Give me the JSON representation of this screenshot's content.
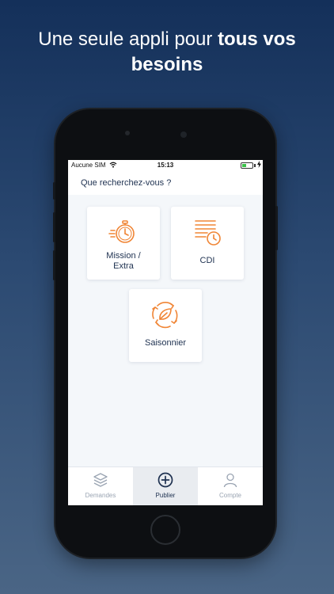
{
  "headline": {
    "line1_plain": "Une seule appli pour ",
    "line1_bold": "tous vos",
    "line2_bold": "besoins"
  },
  "statusbar": {
    "carrier": "Aucune SIM",
    "time": "15:13",
    "wifi_icon": "wifi-icon",
    "charge_icon": "charging-bolt-icon"
  },
  "header": {
    "title": "Que recherchez-vous ?"
  },
  "cards": [
    {
      "label": "Mission /\nExtra",
      "icon": "stopwatch-icon"
    },
    {
      "label": "CDI",
      "icon": "document-clock-icon"
    },
    {
      "label": "Saisonnier",
      "icon": "leaf-cycle-icon"
    }
  ],
  "tabs": [
    {
      "label": "Demandes",
      "icon": "layers-icon",
      "active": false
    },
    {
      "label": "Publier",
      "icon": "plus-circle-icon",
      "active": true
    },
    {
      "label": "Compte",
      "icon": "user-icon",
      "active": false
    }
  ],
  "colors": {
    "accent": "#f08535",
    "navy": "#1e3150",
    "inactive": "#9aa4b2",
    "background_top": "#14305a",
    "background_bottom": "#4a6585"
  }
}
